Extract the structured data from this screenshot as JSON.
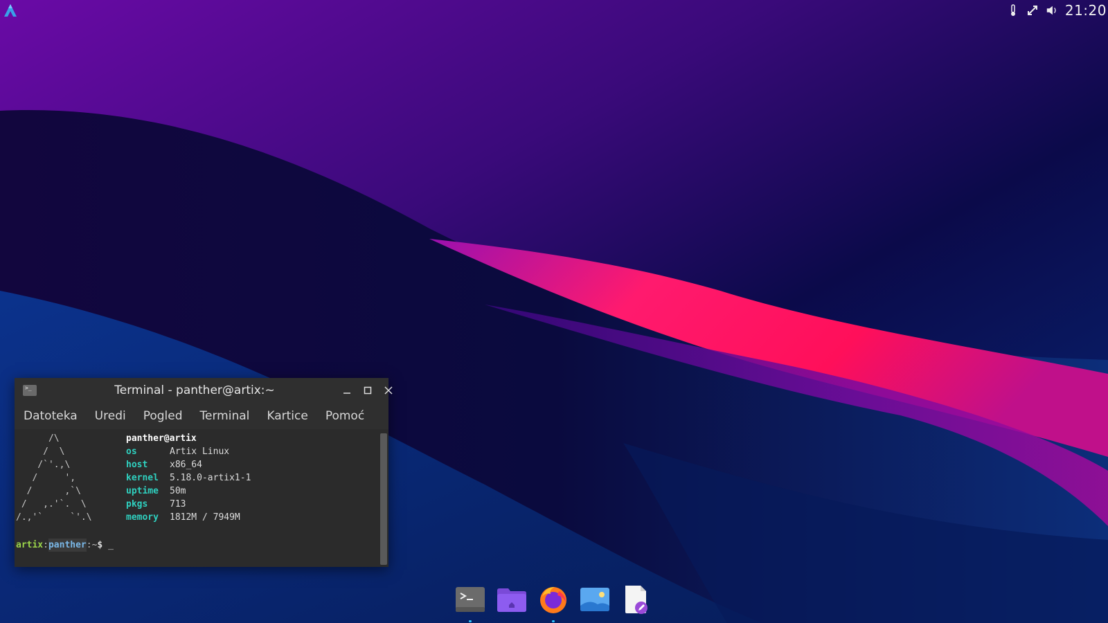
{
  "topbar": {
    "start_icon": "artix-logo-icon",
    "tray_icons": [
      "temperature-icon",
      "network-icon",
      "volume-icon"
    ],
    "clock": "21:20"
  },
  "terminal_window": {
    "title": "Terminal - panther@artix:~",
    "menu": [
      "Datoteka",
      "Uredi",
      "Pogled",
      "Terminal",
      "Kartice",
      "Pomoć"
    ],
    "ascii_logo": "      /\\\n     /  \\\n    /`'.,\\\n   /     ',\n  /      ,`\\\n /   ,.'`.  \\\n/.,'`     `'.\\",
    "fetch": {
      "user_host": "panther@artix",
      "rows": [
        {
          "key": "os",
          "value": "Artix Linux"
        },
        {
          "key": "host",
          "value": "x86_64"
        },
        {
          "key": "kernel",
          "value": "5.18.0-artix1-1"
        },
        {
          "key": "uptime",
          "value": "50m"
        },
        {
          "key": "pkgs",
          "value": "713"
        },
        {
          "key": "memory",
          "value": "1812M / 7949M"
        }
      ]
    },
    "prompt": {
      "host": "artix",
      "sep1": ":",
      "user": "panther",
      "path": ":~",
      "dollar": "$",
      "cursor": "_"
    }
  },
  "dock": {
    "items": [
      {
        "name": "terminal-app-icon",
        "running": true
      },
      {
        "name": "file-manager-icon",
        "running": false
      },
      {
        "name": "firefox-icon",
        "running": true
      },
      {
        "name": "image-viewer-icon",
        "running": false
      },
      {
        "name": "text-editor-icon",
        "running": false
      }
    ]
  },
  "colors": {
    "terminal_bg": "#2b2b2b",
    "fetch_key": "#2fd1c0",
    "prompt_host": "#9bd54a",
    "prompt_user": "#7ab8e8",
    "wallpaper_accent": "#ff1a6e"
  }
}
